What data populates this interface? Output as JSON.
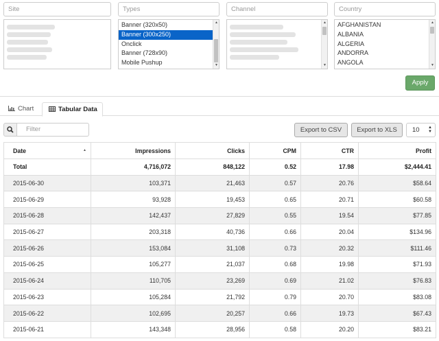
{
  "filters": {
    "site": {
      "placeholder": "Site"
    },
    "types": {
      "placeholder": "Types",
      "options": [
        "Banner (320x50)",
        "Banner (300x250)",
        "Onclick",
        "Banner (728x90)",
        "Mobile Pushup"
      ],
      "selected_index": 1
    },
    "channel": {
      "placeholder": "Channel"
    },
    "country": {
      "placeholder": "Country",
      "options": [
        "AFGHANISTAN",
        "ALBANIA",
        "ALGERIA",
        "ANDORRA",
        "ANGOLA"
      ]
    }
  },
  "apply_label": "Apply",
  "tabs": {
    "chart": "Chart",
    "tabular": "Tabular Data"
  },
  "toolbar": {
    "filter_placeholder": "Filter",
    "export_csv": "Export to CSV",
    "export_xls": "Export to XLS",
    "page_size": "10"
  },
  "table": {
    "columns": [
      "Date",
      "Impressions",
      "Clicks",
      "CPM",
      "CTR",
      "Profit"
    ],
    "total": [
      "Total",
      "4,716,072",
      "848,122",
      "0.52",
      "17.98",
      "$2,444.41"
    ],
    "rows": [
      [
        "2015-06-30",
        "103,371",
        "21,463",
        "0.57",
        "20.76",
        "$58.64"
      ],
      [
        "2015-06-29",
        "93,928",
        "19,453",
        "0.65",
        "20.71",
        "$60.58"
      ],
      [
        "2015-06-28",
        "142,437",
        "27,829",
        "0.55",
        "19.54",
        "$77.85"
      ],
      [
        "2015-06-27",
        "203,318",
        "40,736",
        "0.66",
        "20.04",
        "$134.96"
      ],
      [
        "2015-06-26",
        "153,084",
        "31,108",
        "0.73",
        "20.32",
        "$111.46"
      ],
      [
        "2015-06-25",
        "105,277",
        "21,037",
        "0.68",
        "19.98",
        "$71.93"
      ],
      [
        "2015-06-24",
        "110,705",
        "23,269",
        "0.69",
        "21.02",
        "$76.83"
      ],
      [
        "2015-06-23",
        "105,284",
        "21,792",
        "0.79",
        "20.70",
        "$83.08"
      ],
      [
        "2015-06-22",
        "102,695",
        "20,257",
        "0.66",
        "19.73",
        "$67.43"
      ],
      [
        "2015-06-21",
        "143,348",
        "28,956",
        "0.58",
        "20.20",
        "$83.21"
      ]
    ]
  }
}
